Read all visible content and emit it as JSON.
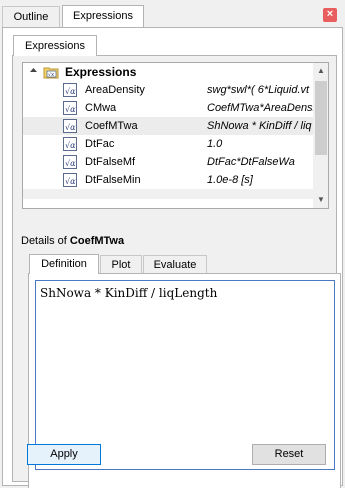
{
  "view_tabs": [
    {
      "label": "Outline"
    },
    {
      "label": "Expressions"
    }
  ],
  "close_glyph": "×",
  "inner_tab_label": "Expressions",
  "tree": {
    "root_label": "Expressions",
    "root_toggle": "▲",
    "rows": [
      {
        "name": "AreaDensity",
        "value": "swg*swl*( 6*Liquid.vt"
      },
      {
        "name": "CMwa",
        "value": "CoefMTwa*AreaDensi"
      },
      {
        "name": "CoefMTwa",
        "value": "ShNowa * KinDiff / liq"
      },
      {
        "name": "DtFac",
        "value": "1.0"
      },
      {
        "name": "DtFalseMf",
        "value": "DtFac*DtFalseWa"
      },
      {
        "name": "DtFalseMin",
        "value": "1.0e-8 [s]"
      }
    ],
    "selected_index": 2
  },
  "details": {
    "prefix": "Details of ",
    "name": "CoefMTwa"
  },
  "detail_tabs": [
    {
      "label": "Definition"
    },
    {
      "label": "Plot"
    },
    {
      "label": "Evaluate"
    }
  ],
  "definition_text": "ShNowa * KinDiff / liqLength",
  "buttons": {
    "apply": "Apply",
    "reset": "Reset"
  },
  "colors": {
    "focus_border": "#4a78c2",
    "close_bg": "#e85d5d"
  }
}
